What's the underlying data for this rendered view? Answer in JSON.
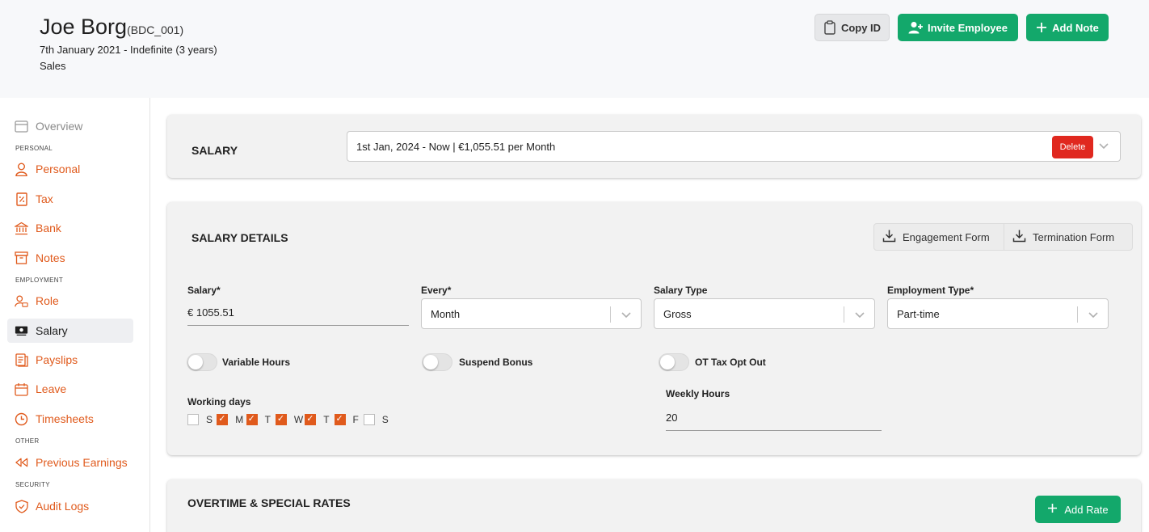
{
  "header": {
    "name": "Joe Borg",
    "code": "(BDC_001)",
    "dates": "7th January 2021 - Indefinite (3 years)",
    "department": "Sales",
    "copy_label": "Copy ID",
    "invite_label": "Invite Employee",
    "note_label": "Add Note"
  },
  "sidebar": {
    "overview": "Overview",
    "sections": {
      "personal": "PERSONAL",
      "employment": "EMPLOYMENT",
      "other": "OTHER",
      "security": "SECURITY"
    },
    "items": {
      "personal": "Personal",
      "tax": "Tax",
      "bank": "Bank",
      "notes": "Notes",
      "role": "Role",
      "salary": "Salary",
      "payslips": "Payslips",
      "leave": "Leave",
      "timesheets": "Timesheets",
      "previous_earnings": "Previous Earnings",
      "audit_logs": "Audit Logs"
    }
  },
  "salary_card": {
    "title": "SALARY",
    "selected_period": "1st Jan, 2024 - Now | €1,055.51 per Month",
    "delete_label": "Delete"
  },
  "details_card": {
    "title": "SALARY DETAILS",
    "engagement_label": "Engagement Form",
    "termination_label": "Termination Form",
    "salary_label": "Salary*",
    "salary_value": "€ 1055.51",
    "every_label": "Every*",
    "every_value": "Month",
    "salary_type_label": "Salary Type",
    "salary_type_value": "Gross",
    "employment_type_label": "Employment Type*",
    "employment_type_value": "Part-time",
    "toggles": {
      "variable_hours": "Variable Hours",
      "suspend_bonus": "Suspend Bonus",
      "ot_tax_opt_out": "OT Tax Opt Out"
    },
    "working_days_label": "Working days",
    "days": [
      "S",
      "M",
      "T",
      "W",
      "T",
      "F",
      "S"
    ],
    "days_checked": [
      false,
      true,
      true,
      true,
      true,
      true,
      false
    ],
    "weekly_hours_label": "Weekly Hours",
    "weekly_hours_value": "20"
  },
  "ot_card": {
    "title": "OVERTIME & SPECIAL RATES",
    "add_rate_label": "Add Rate"
  },
  "colors": {
    "accent": "#e05a1c",
    "green": "#13a86b",
    "danger": "#e0281f"
  }
}
